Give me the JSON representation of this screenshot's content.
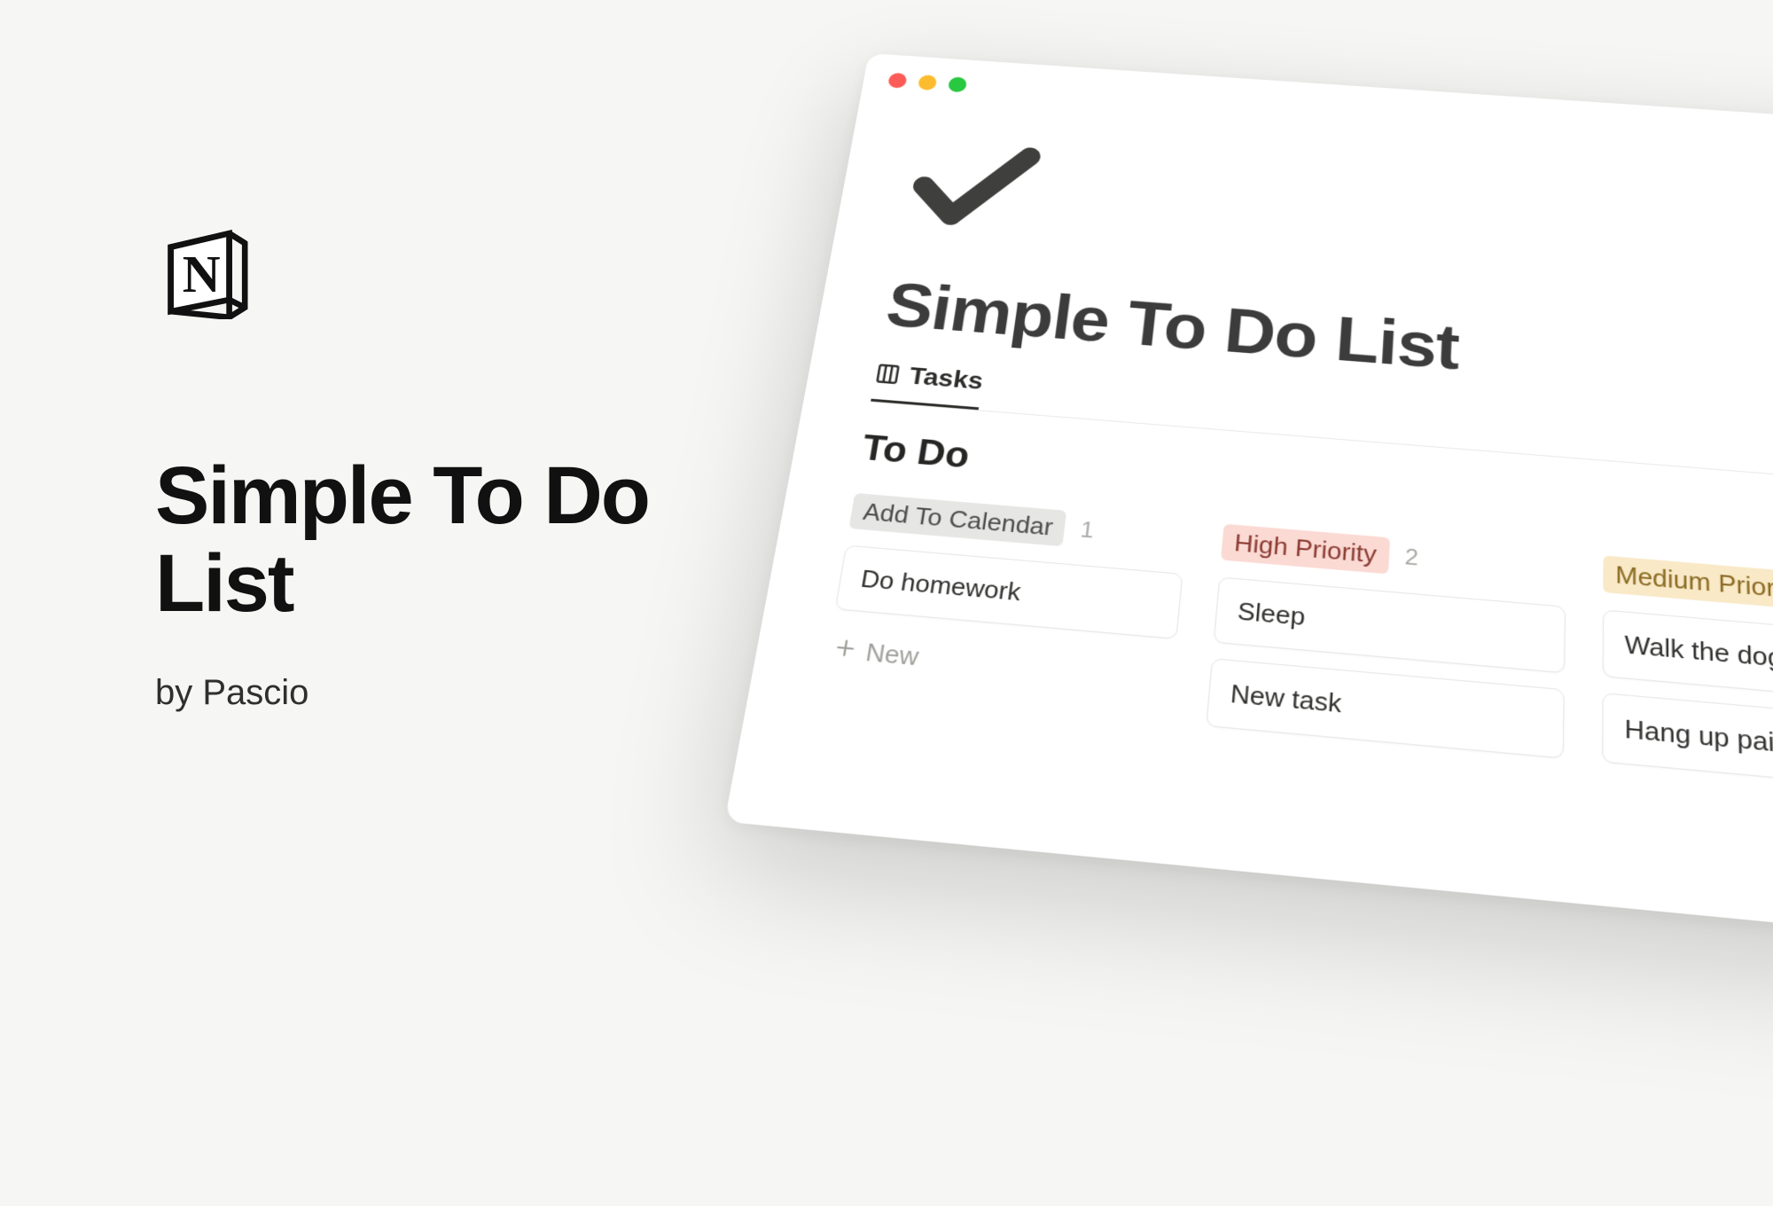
{
  "promo": {
    "title": "Simple To Do List",
    "byline": "by Pascio"
  },
  "app": {
    "title": "Simple To Do List",
    "tabs": [
      {
        "label": "Tasks",
        "active": true
      }
    ],
    "section": "To Do",
    "columns": [
      {
        "tag": "Add To Calendar",
        "tag_style": "grey",
        "count": "1",
        "cards": [
          "Do homework"
        ],
        "new_label": "New"
      },
      {
        "tag": "High Priority",
        "tag_style": "red",
        "count": "2",
        "cards": [
          "Sleep",
          "New task"
        ]
      },
      {
        "tag": "Medium Priority",
        "tag_style": "yellow",
        "count": "",
        "cards": [
          "Walk the dog",
          "Hang up paintin"
        ]
      }
    ]
  }
}
